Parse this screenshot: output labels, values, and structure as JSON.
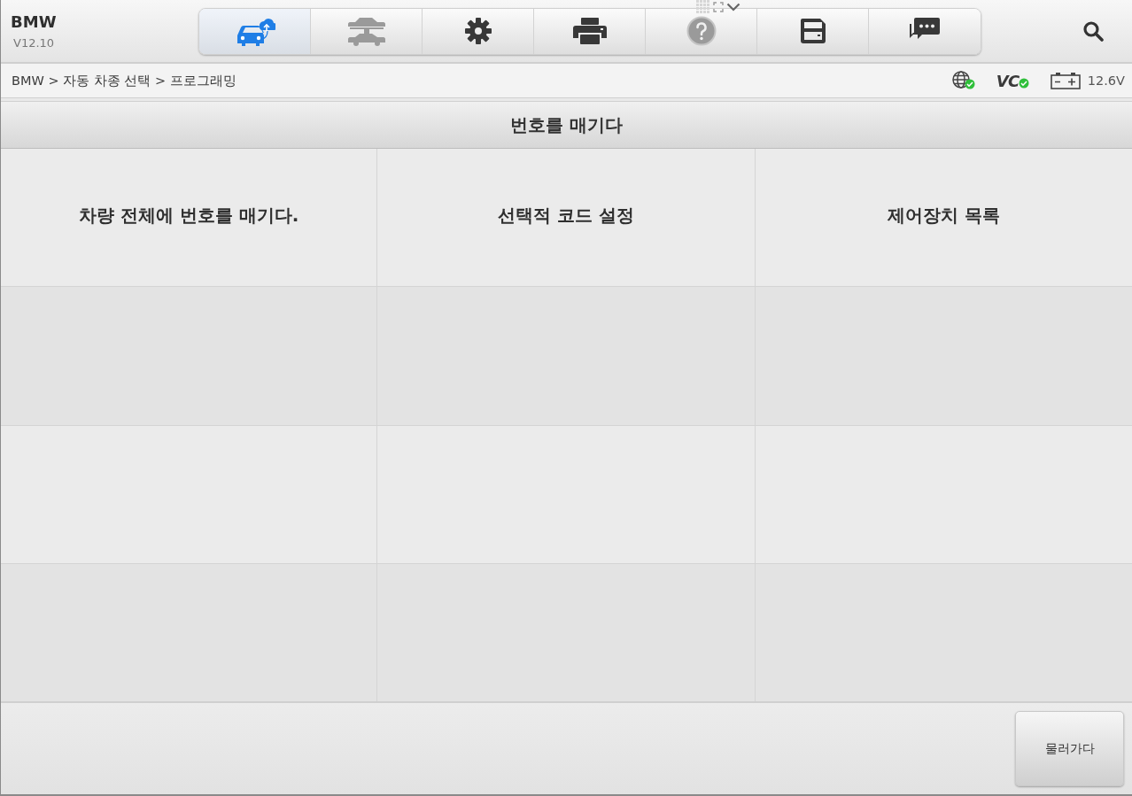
{
  "header": {
    "brand": "BMW",
    "version": "V12.10"
  },
  "toolbar": [
    {
      "kind": "vehicle-cloud",
      "selected": true,
      "disabled": false
    },
    {
      "kind": "car-lift",
      "selected": false,
      "disabled": true
    },
    {
      "kind": "settings",
      "selected": false,
      "disabled": false
    },
    {
      "kind": "print",
      "selected": false,
      "disabled": false
    },
    {
      "kind": "help",
      "selected": false,
      "disabled": true
    },
    {
      "kind": "save",
      "selected": false,
      "disabled": false
    },
    {
      "kind": "messages",
      "selected": false,
      "disabled": false
    }
  ],
  "breadcrumb": "BMW > 자동 차종 선택 > 프로그래밍",
  "status": {
    "network": {
      "connected": true
    },
    "vci": {
      "label": "VC",
      "connected": true
    },
    "battery": {
      "reading": "12.6V"
    }
  },
  "page_title": "번호를 매기다",
  "menu_items": [
    "차량 전체에 번호를 매기다.",
    "선택적 코드 설정",
    "제어장치 목록"
  ],
  "footer": {
    "buttons": [
      "물러가다"
    ]
  }
}
